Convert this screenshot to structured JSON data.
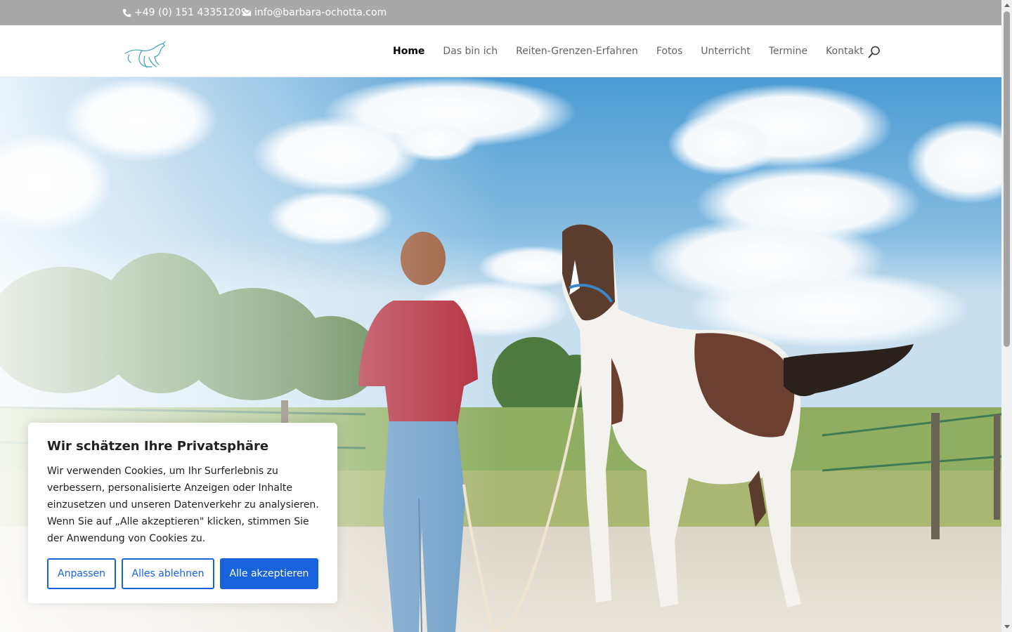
{
  "topbar": {
    "phone": "+49 (0) 151 43351209",
    "email": "info@barbara-ochotta.com"
  },
  "nav": {
    "items": [
      "Home",
      "Das bin ich",
      "Reiten-Grenzen-Erfahren",
      "Fotos",
      "Unterricht",
      "Termine",
      "Kontakt"
    ],
    "active": "Home"
  },
  "cookie": {
    "title": "Wir schätzen Ihre Privatsphäre",
    "text": "Wir verwenden Cookies, um Ihr Surferlebnis zu verbessern, personalisierte Anzeigen oder Inhalte einzusetzen und unseren Datenverkehr zu analysieren. Wenn Sie auf „Alle akzeptieren\" klicken, stimmen Sie der Anwendung von Cookies zu.",
    "btn_customize": "Anpassen",
    "btn_reject": "Alles ablehnen",
    "btn_accept": "Alle akzeptieren"
  },
  "colors": {
    "topbar_bg": "#a8a8a8",
    "accent_blue": "#1863dc",
    "logo_teal": "#3aa6b0"
  },
  "icons": {
    "phone": "phone-icon",
    "email": "envelope-icon",
    "search": "search-icon",
    "logo": "horse-logo"
  }
}
